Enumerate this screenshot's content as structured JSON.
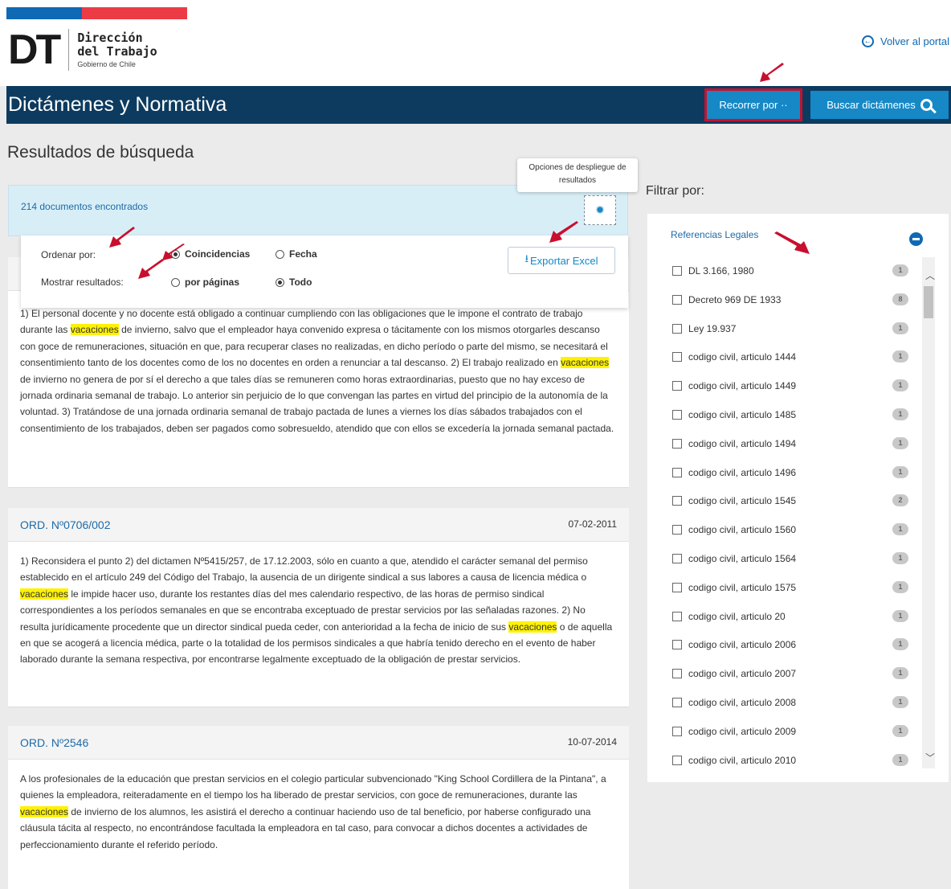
{
  "header": {
    "brand_initials": "DT",
    "brand_line1": "Dirección",
    "brand_line2": "del Trabajo",
    "brand_line3": "Gobierno de Chile",
    "back_link": "Volver al portal"
  },
  "nav": {
    "title": "Dictámenes y Normativa",
    "recorrer_label": "Recorrer por ··",
    "buscar_label": "Buscar dictámenes"
  },
  "results": {
    "heading": "Resultados de búsqueda",
    "count": "214 documentos encontrados",
    "tooltip": "Opciones de despliegue de resultados",
    "order_label": "Ordenar por:",
    "order_options": [
      "Coincidencias",
      "Fecha"
    ],
    "order_selected": "Coincidencias",
    "show_label": "Mostrar resultados:",
    "show_options": [
      "por páginas",
      "Todo"
    ],
    "show_selected": "Todo",
    "export_label": "Exportar Excel"
  },
  "cards": [
    {
      "id": "",
      "date": "",
      "segments": [
        {
          "t": "1) El personal docente y no docente está obligado a continuar cumpliendo con las obligaciones que le impone el contrato de trabajo durante las "
        },
        {
          "t": "vacaciones",
          "hl": true
        },
        {
          "t": " de invierno, salvo que el empleador haya convenido expresa o tácitamente con los mismos otorgarles descanso con goce de remuneraciones, situación en que, para recuperar clases no realizadas, en dicho período o parte del mismo, se necesitará el consentimiento tanto de los docentes como de los no docentes en orden a renunciar a tal descanso. 2) El trabajo realizado en "
        },
        {
          "t": "vacaciones",
          "hl": true
        },
        {
          "t": " de invierno no genera de por sí el derecho a que tales días se remuneren como horas extraordinarias, puesto que no hay exceso de jornada ordinaria semanal de trabajo. Lo anterior sin perjuicio de lo que convengan las partes en virtud del principio de la autonomía de la voluntad. 3) Tratándose de una jornada ordinaria semanal de trabajo pactada de lunes a viernes los días sábados trabajados con el consentimiento de los trabajados, deben ser pagados como sobresueldo, atendido que con ellos se excedería la jornada semanal pactada."
        }
      ]
    },
    {
      "id": "ORD. Nº0706/002",
      "date": "07-02-2011",
      "segments": [
        {
          "t": "1) Reconsidera el punto 2) del dictamen Nº5415/257, de 17.12.2003, sólo en cuanto a que, atendido el carácter semanal del permiso establecido en el artículo 249 del Código del Trabajo, la ausencia de un dirigente sindical a sus labores a causa de licencia médica o "
        },
        {
          "t": "vacaciones",
          "hl": true
        },
        {
          "t": " le impide hacer uso, durante los restantes días del mes calendario respectivo, de las horas de permiso sindical correspondientes a los períodos semanales en que se encontraba exceptuado de prestar servicios por las señaladas razones. 2) No resulta jurídicamente procedente que un director sindical pueda ceder, con anterioridad a la fecha de inicio de sus "
        },
        {
          "t": "vacaciones",
          "hl": true
        },
        {
          "t": " o de aquella en que se acogerá a licencia médica, parte o la totalidad de los permisos sindicales a que habría tenido derecho en el evento de haber laborado durante la semana respectiva, por encontrarse legalmente exceptuado de la obligación de prestar servicios."
        }
      ]
    },
    {
      "id": "ORD. Nº2546",
      "date": "10-07-2014",
      "segments": [
        {
          "t": "A los profesionales de la educación que prestan servicios en el colegio particular subvencionado \"King School Cordillera de la Pintana\", a quienes la empleadora, reiteradamente en el tiempo los ha liberado de prestar servicios, con goce de remuneraciones, durante las "
        },
        {
          "t": "vacaciones",
          "hl": true
        },
        {
          "t": " de invierno de los alumnos, les asistirá el derecho a continuar haciendo uso de tal beneficio, por haberse configurado una cláusula tácita al respecto, no encontrándose facultada la empleadora en tal caso, para convocar a dichos docentes a actividades de perfeccionamiento durante el referido período."
        }
      ]
    }
  ],
  "filter": {
    "title": "Filtrar por:",
    "section": "Referencias Legales",
    "items": [
      {
        "label": "DL 3.166, 1980",
        "count": "1"
      },
      {
        "label": "Decreto 969 DE 1933",
        "count": "8"
      },
      {
        "label": "Ley 19.937",
        "count": "1"
      },
      {
        "label": "codigo civil, articulo 1444",
        "count": "1"
      },
      {
        "label": "codigo civil, articulo 1449",
        "count": "1"
      },
      {
        "label": "codigo civil, articulo 1485",
        "count": "1"
      },
      {
        "label": "codigo civil, articulo 1494",
        "count": "1"
      },
      {
        "label": "codigo civil, articulo 1496",
        "count": "1"
      },
      {
        "label": "codigo civil, articulo 1545",
        "count": "2"
      },
      {
        "label": "codigo civil, articulo 1560",
        "count": "1"
      },
      {
        "label": "codigo civil, articulo 1564",
        "count": "1"
      },
      {
        "label": "codigo civil, articulo 1575",
        "count": "1"
      },
      {
        "label": "codigo civil, articulo 20",
        "count": "1"
      },
      {
        "label": "codigo civil, articulo 2006",
        "count": "1"
      },
      {
        "label": "codigo civil, articulo 2007",
        "count": "1"
      },
      {
        "label": "codigo civil, articulo 2008",
        "count": "1"
      },
      {
        "label": "codigo civil, articulo 2009",
        "count": "1"
      },
      {
        "label": "codigo civil, articulo 2010",
        "count": "1"
      }
    ]
  },
  "colors": {
    "navbar": "#0d3b5f",
    "button": "#1688c6",
    "highlight": "#fff200",
    "annotation": "#c8102e"
  }
}
